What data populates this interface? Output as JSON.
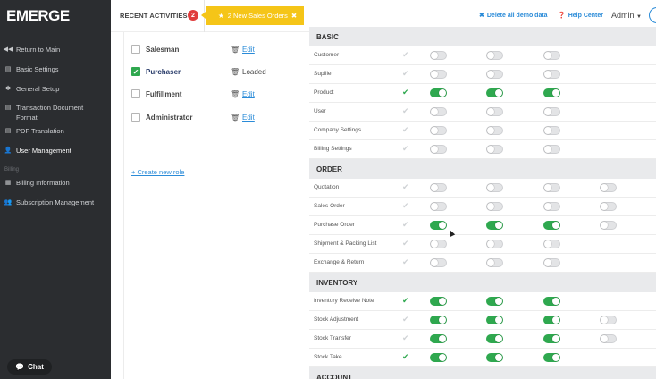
{
  "sidebar": {
    "logo": "EMERGE",
    "items": [
      {
        "label": "Return to Main",
        "icon": "arrow-left-icon"
      },
      {
        "label": "Basic Settings",
        "icon": "file-icon"
      },
      {
        "label": "General Setup",
        "icon": "gear-icon"
      },
      {
        "label": "Transaction Document Format",
        "icon": "document-icon"
      },
      {
        "label": "PDF Translation",
        "icon": "document-icon"
      },
      {
        "label": "User Management",
        "icon": "users-icon"
      },
      {
        "label": "Billing Information",
        "icon": "calendar-icon"
      },
      {
        "label": "Subscription Management",
        "icon": "users-icon"
      }
    ],
    "section_billing": "Billing",
    "chat_label": "Chat"
  },
  "topbar": {
    "recent_activities": "RECENT ACTIVITIES",
    "badge_count": "2",
    "notification": "2 New Sales Orders",
    "delete_demo": "Delete all demo data",
    "help_center": "Help Center",
    "admin": "Admin"
  },
  "roles": {
    "items": [
      {
        "name": "Salesman",
        "checked": false,
        "action": "Edit"
      },
      {
        "name": "Purchaser",
        "checked": true,
        "action": "Loaded"
      },
      {
        "name": "Fulfillment",
        "checked": false,
        "action": "Edit"
      },
      {
        "name": "Administrator",
        "checked": false,
        "action": "Edit"
      }
    ],
    "create_label": "+ Create new role"
  },
  "permissions": {
    "sections": [
      {
        "title": "BASIC",
        "rows": [
          {
            "label": "Customer",
            "check": false,
            "toggles": [
              false,
              false,
              false
            ]
          },
          {
            "label": "Supllier",
            "check": false,
            "toggles": [
              false,
              false,
              false
            ]
          },
          {
            "label": "Product",
            "check": true,
            "toggles": [
              true,
              true,
              true
            ]
          },
          {
            "label": "User",
            "check": false,
            "toggles": [
              false,
              false,
              false
            ]
          },
          {
            "label": "Company Settings",
            "check": false,
            "toggles": [
              false,
              false,
              false
            ]
          },
          {
            "label": "Billing Settings",
            "check": false,
            "toggles": [
              false,
              false,
              false
            ]
          }
        ]
      },
      {
        "title": "ORDER",
        "rows": [
          {
            "label": "Quotation",
            "check": false,
            "toggles": [
              false,
              false,
              false,
              false
            ]
          },
          {
            "label": "Sales Order",
            "check": false,
            "toggles": [
              false,
              false,
              false,
              false
            ]
          },
          {
            "label": "Purchase Order",
            "check": false,
            "toggles": [
              true,
              true,
              true,
              false
            ]
          },
          {
            "label": "Shipment & Packing List",
            "check": false,
            "toggles": [
              false,
              false,
              false
            ]
          },
          {
            "label": "Exchange & Return",
            "check": false,
            "toggles": [
              false,
              false,
              false
            ]
          }
        ]
      },
      {
        "title": "INVENTORY",
        "rows": [
          {
            "label": "Inventory Receive Note",
            "check": true,
            "toggles": [
              true,
              true,
              true
            ]
          },
          {
            "label": "Stock Adjustment",
            "check": false,
            "toggles": [
              true,
              true,
              true,
              false
            ]
          },
          {
            "label": "Stock Transfer",
            "check": false,
            "toggles": [
              true,
              true,
              true,
              false
            ]
          },
          {
            "label": "Stock Take",
            "check": true,
            "toggles": [
              true,
              true,
              true
            ]
          }
        ]
      },
      {
        "title": "ACCOUNT",
        "rows": []
      }
    ]
  },
  "colors": {
    "accent": "#2a8bd8",
    "green": "#2fa84f",
    "sidebar": "#2b2d30",
    "notification": "#f5c518"
  }
}
